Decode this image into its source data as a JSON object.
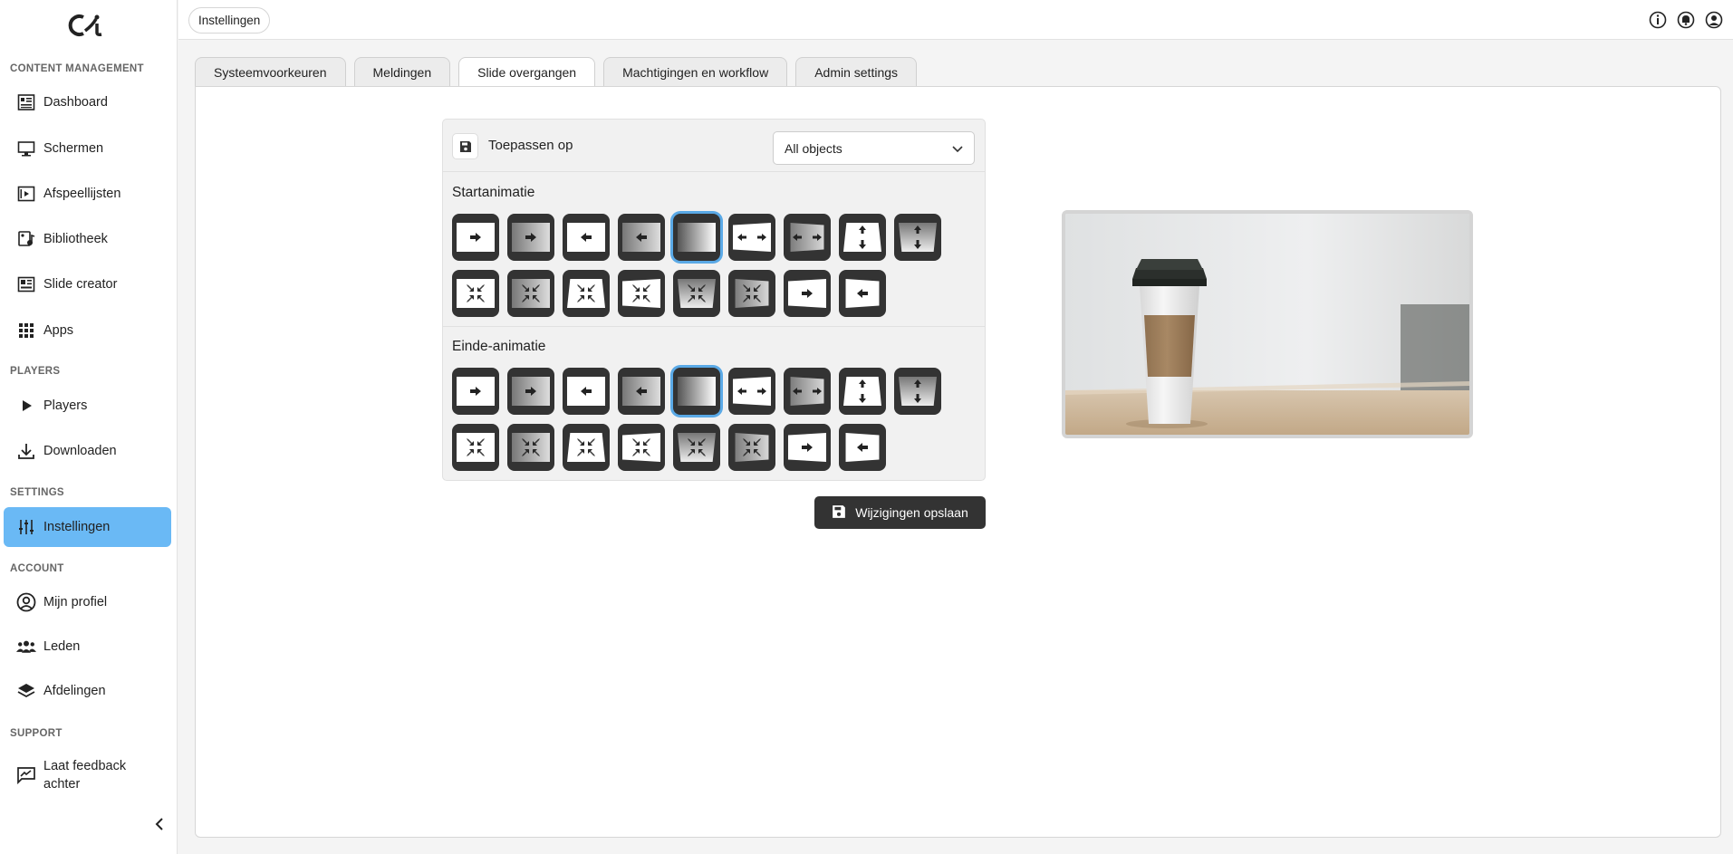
{
  "sidebar": {
    "sections": {
      "content": "CONTENT MANAGEMENT",
      "players": "PLAYERS",
      "settings": "SETTINGS",
      "account": "ACCOUNT",
      "support": "SUPPORT"
    },
    "items": [
      {
        "label": "Dashboard",
        "icon": "dashboard-icon"
      },
      {
        "label": "Schermen",
        "icon": "monitor-icon"
      },
      {
        "label": "Afspeellijsten",
        "icon": "playlist-icon"
      },
      {
        "label": "Bibliotheek",
        "icon": "library-icon"
      },
      {
        "label": "Slide creator",
        "icon": "slide-creator-icon"
      },
      {
        "label": "Apps",
        "icon": "apps-grid-icon"
      },
      {
        "label": "Players",
        "icon": "play-icon"
      },
      {
        "label": "Downloaden",
        "icon": "download-icon"
      },
      {
        "label": "Instellingen",
        "icon": "sliders-icon",
        "active": true
      },
      {
        "label": "Mijn profiel",
        "icon": "user-circle-icon"
      },
      {
        "label": "Leden",
        "icon": "users-icon"
      },
      {
        "label": "Afdelingen",
        "icon": "layers-icon"
      },
      {
        "label": "Laat feedback achter",
        "icon": "feedback-icon"
      }
    ]
  },
  "header": {
    "breadcrumb": "Instellingen",
    "icons": [
      "info-icon",
      "bell-icon",
      "account-icon"
    ]
  },
  "tabs": [
    {
      "label": "Systeemvoorkeuren"
    },
    {
      "label": "Meldingen"
    },
    {
      "label": "Slide overgangen",
      "active": true
    },
    {
      "label": "Machtigingen en workflow"
    },
    {
      "label": "Admin settings"
    }
  ],
  "transitions": {
    "apply_label": "Toepassen op",
    "apply_value": "All objects",
    "start_label": "Startanimatie",
    "end_label": "Einde-animatie",
    "selected_start_index": 4,
    "selected_end_index": 4,
    "save_label": "Wijzigingen opslaan"
  },
  "colors": {
    "accent": "#6ab9f5",
    "selected_outline": "#5aa9e6",
    "dark_button": "#333333"
  }
}
